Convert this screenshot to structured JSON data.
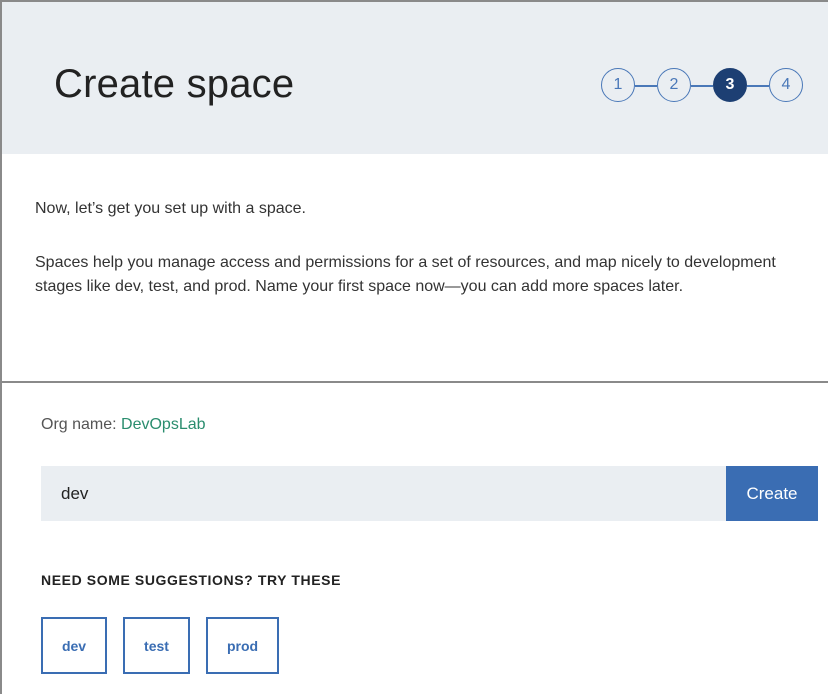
{
  "header": {
    "title": "Create space",
    "steps": [
      {
        "label": "1",
        "active": false
      },
      {
        "label": "2",
        "active": false
      },
      {
        "label": "3",
        "active": true
      },
      {
        "label": "4",
        "active": false
      }
    ]
  },
  "intro": {
    "line1": "Now, let’s get you set up with a space.",
    "line2": "Spaces help you manage access and permissions for a set of resources, and map nicely to development stages like dev, test, and prod. Name your first space now—you can add more spaces later."
  },
  "org": {
    "label": "Org name: ",
    "value": "DevOpsLab"
  },
  "form": {
    "input_value": "dev",
    "create_label": "Create"
  },
  "suggestions": {
    "heading": "NEED SOME SUGGESTIONS? TRY THESE",
    "chips": [
      "dev",
      "test",
      "prod"
    ]
  },
  "colors": {
    "header_bg": "#eaeef2",
    "accent_blue": "#3a6db3",
    "active_step": "#1d3f73",
    "org_green": "#2a8d6e"
  }
}
